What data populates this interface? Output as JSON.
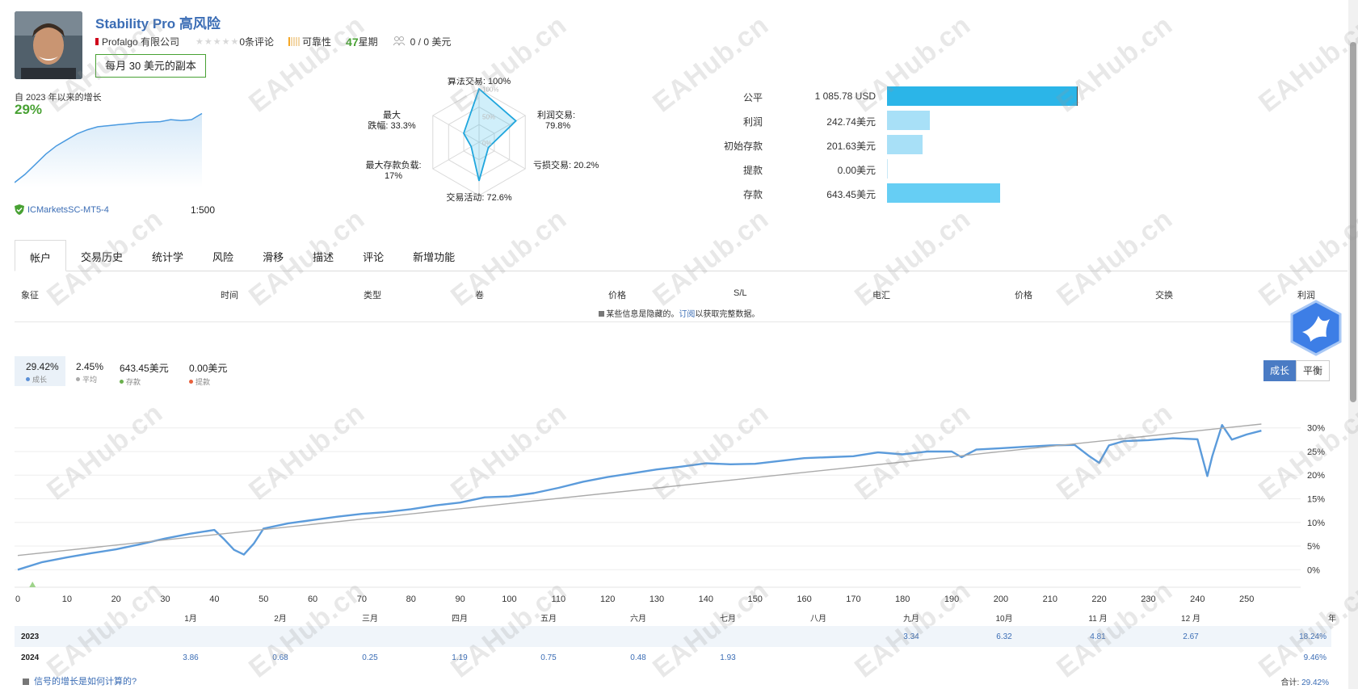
{
  "signal": {
    "title": "Stability Pro 高风险",
    "author": "Profalgo 有限公司",
    "stars_glyphs": "★★★★★",
    "reviews": "0条评论",
    "reliability_label": "可靠性",
    "weeks_num": "47",
    "weeks_label": "星期",
    "subscribers": "0 / 0 美元",
    "copy_button": "每月 30 美元的副本"
  },
  "growth": {
    "label": "自 2023 年以来的增长",
    "value": "29%",
    "mini_series": [
      0,
      4,
      9,
      14,
      18,
      21,
      24,
      26,
      27.5,
      28,
      28.5,
      29,
      29.5,
      29.8,
      30,
      31,
      30.5,
      31,
      34
    ]
  },
  "account": {
    "broker": "ICMarketsSC-MT5-4",
    "leverage": "1:500"
  },
  "radar": {
    "algo_label": "算法交易:",
    "algo_value": "100%",
    "profit_label": "利润交易:",
    "profit_value": "79.8%",
    "loss_label": "亏损交易:",
    "loss_value": "20.2%",
    "activity_label": "交易活动:",
    "activity_value": "72.6%",
    "deposit_load_label": "最大存款负载:",
    "deposit_load_value": "17%",
    "drawdown_label1": "最大",
    "drawdown_label2": "跌幅:",
    "drawdown_value": "33.3%",
    "grid_100": "100%",
    "grid_50": "50%",
    "grid_0": "0%",
    "values": [
      1.0,
      0.798,
      0.202,
      0.726,
      0.17,
      0.333
    ]
  },
  "balance": [
    {
      "label": "公平",
      "value": "1 085.78 USD",
      "amount": 1085.78,
      "color": "#2bb5e8"
    },
    {
      "label": "利润",
      "value": "242.74美元",
      "amount": 242.74,
      "color": "#a8e0f7"
    },
    {
      "label": "初始存款",
      "value": "201.63美元",
      "amount": 201.63,
      "color": "#a8e0f7"
    },
    {
      "label": "提款",
      "value": "0.00美元",
      "amount": 0,
      "color": "#a8e0f7"
    },
    {
      "label": "存款",
      "value": "643.45美元",
      "amount": 643.45,
      "color": "#66cef4"
    }
  ],
  "tabs": [
    "帐户",
    "交易历史",
    "统计学",
    "风险",
    "滑移",
    "描述",
    "评论",
    "新增功能"
  ],
  "table_columns": [
    "象征",
    "时间",
    "类型",
    "卷",
    "价格",
    "S/L",
    "电汇",
    "价格",
    "交换",
    "利润"
  ],
  "hidden_note": {
    "before": "某些信息是隐藏的。",
    "link": "订阅",
    "after": "以获取完整数据。"
  },
  "stats": [
    {
      "value": "29.42%",
      "label": "成长",
      "color": "#5b8fd6"
    },
    {
      "value": "2.45%",
      "label": "平均",
      "color": "#aaaaaa"
    },
    {
      "value": "643.45美元",
      "label": "存款",
      "color": "#6ab04c"
    },
    {
      "value": "0.00美元",
      "label": "提款",
      "color": "#e8603c"
    }
  ],
  "toggle": {
    "growth": "成长",
    "balance": "平衡"
  },
  "chart_data": {
    "type": "line",
    "x_ticks": [
      0,
      10,
      20,
      30,
      40,
      50,
      60,
      70,
      80,
      90,
      100,
      110,
      120,
      130,
      140,
      150,
      160,
      170,
      180,
      190,
      200,
      210,
      220,
      230,
      240,
      250
    ],
    "y_ticks": [
      "0%",
      "5%",
      "10%",
      "15%",
      "20%",
      "25%",
      "30%"
    ],
    "xlim": [
      0,
      260
    ],
    "ylim": [
      -2,
      32
    ],
    "series": [
      {
        "x": [
          0,
          5,
          10,
          15,
          20,
          25,
          30,
          35,
          40,
          42,
          44,
          46,
          48,
          50,
          55,
          60,
          65,
          70,
          75,
          80,
          85,
          90,
          95,
          100,
          105,
          110,
          115,
          120,
          125,
          130,
          135,
          140,
          145,
          150,
          155,
          160,
          165,
          170,
          175,
          180,
          185,
          190,
          192,
          195,
          200,
          205,
          210,
          215,
          218,
          220,
          222,
          225,
          230,
          235,
          240,
          242,
          243,
          245,
          247,
          250,
          253
        ],
        "y": [
          0,
          1.6,
          2.6,
          3.5,
          4.3,
          5.4,
          6.6,
          7.6,
          8.4,
          6.4,
          4.2,
          3.2,
          5.5,
          8.7,
          9.8,
          10.5,
          11.2,
          11.8,
          12.2,
          12.8,
          13.6,
          14.2,
          15.3,
          15.5,
          16.2,
          17.3,
          18.6,
          19.6,
          20.4,
          21.2,
          21.8,
          22.5,
          22.3,
          22.4,
          23.0,
          23.6,
          23.8,
          24.0,
          24.8,
          24.4,
          25.0,
          25.0,
          23.8,
          25.4,
          25.7,
          26.0,
          26.3,
          26.4,
          24.0,
          22.6,
          26.3,
          27.2,
          27.4,
          27.8,
          27.6,
          19.8,
          24.0,
          30.6,
          27.5,
          28.6,
          29.4
        ],
        "color": "#5b9bdb"
      },
      {
        "x": [
          0,
          253
        ],
        "y": [
          3.0,
          30.8
        ],
        "color": "#aaaaaa"
      }
    ]
  },
  "monthly": {
    "months": [
      "1月",
      "2月",
      "三月",
      "四月",
      "五月",
      "六月",
      "七月",
      "八月",
      "九月",
      "10月",
      "11 月",
      "12 月",
      "年"
    ],
    "rows": [
      {
        "year": "2023",
        "cells": [
          "",
          "",
          "",
          "",
          "",
          "",
          "",
          "",
          "3.34",
          "6.32",
          "4.81",
          "2.67"
        ],
        "total": "18.24%"
      },
      {
        "year": "2024",
        "cells": [
          "3.86",
          "0.68",
          "0.25",
          "1.19",
          "0.75",
          "0.48",
          "1.93",
          "",
          "",
          "",
          "",
          ""
        ],
        "total": "9.46%"
      }
    ]
  },
  "footer": {
    "note": "信号的增长是如何计算的?",
    "total_label": "合计:",
    "total_value": "29.42%"
  },
  "watermark": "EAHub.cn"
}
